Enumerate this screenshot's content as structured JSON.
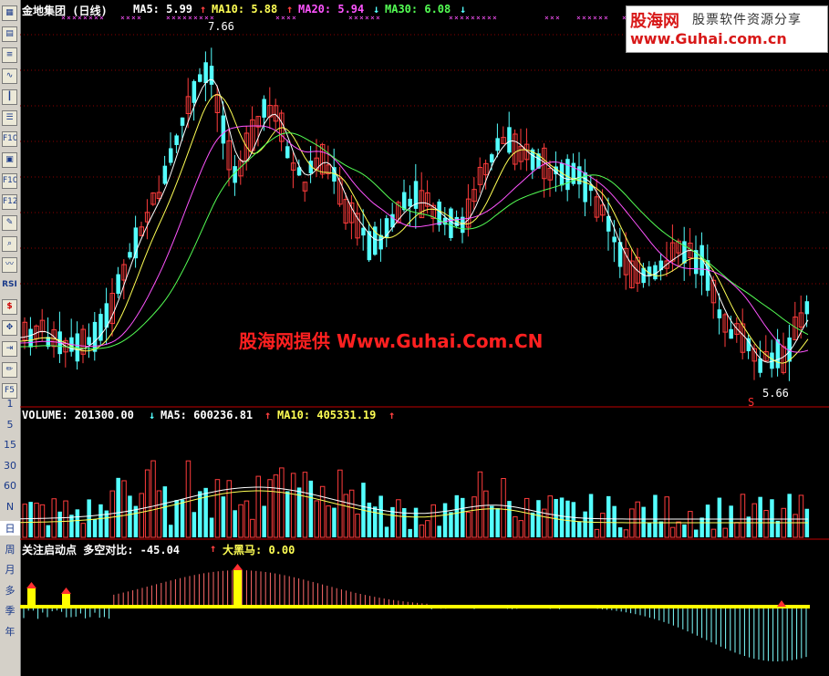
{
  "toolbar": {
    "icons": [
      "chart-icon",
      "table-icon",
      "flow-icon",
      "line-icon",
      "kline-icon",
      "list-icon",
      "f10-icon",
      "doc-icon",
      "f10b-icon",
      "f12-icon",
      "note-icon",
      "search-icon",
      "wave-icon",
      "rsi-icon",
      "dollar-icon",
      "move-icon",
      "exit-icon",
      "pencil-icon",
      "f5-icon"
    ],
    "f10": "F10",
    "f12": "F12",
    "rsi": "RSI",
    "f5": "F5",
    "periods": [
      "1",
      "5",
      "15",
      "30",
      "60",
      "N",
      "日",
      "周",
      "月",
      "多",
      "季",
      "年"
    ]
  },
  "header": {
    "title": "金地集团 (日线)",
    "ma5": "MA5: 5.99",
    "ma10": "MA10: 5.88",
    "ma20": "MA20: 5.94",
    "ma30": "MA30: 6.08",
    "arrow_up": "↑",
    "arrow_down": "↓",
    "high_label": "7.66",
    "low_label": "5.66",
    "signal": "S"
  },
  "volume": {
    "label": "VOLUME: 201300.00",
    "ma5": "MA5: 600236.81",
    "ma10": "MA10: 405331.19"
  },
  "indicator": {
    "label1": "关注启动点  多空对比: -45.04",
    "label2": "大黑马: 0.00"
  },
  "logo": {
    "name": "股海网",
    "slogan": "股票软件资源分享",
    "url": "www.Guhai.com.cn"
  },
  "watermark": "股海网提供 Www.Guhai.Com.CN",
  "colors": {
    "up": "#ff3c3c",
    "down": "#54ffff",
    "ma5": "#ffffff",
    "ma10": "#ffff54",
    "ma20": "#ff54ff",
    "ma30": "#54ff54",
    "grid": "#8b0000",
    "indicator_bar": "#ffff00"
  },
  "chart_data": {
    "type": "candlestick",
    "title": "金地集团 (日线)",
    "price_range": [
      5.66,
      7.66
    ],
    "high": 7.66,
    "low": 5.66,
    "ma": {
      "ma5": 5.99,
      "ma10": 5.88,
      "ma20": 5.94,
      "ma30": 6.08
    },
    "volume": 201300.0,
    "volume_ma5": 600236.81,
    "volume_ma10": 405331.19,
    "indicator_value": -45.04,
    "big_horse": 0.0
  }
}
